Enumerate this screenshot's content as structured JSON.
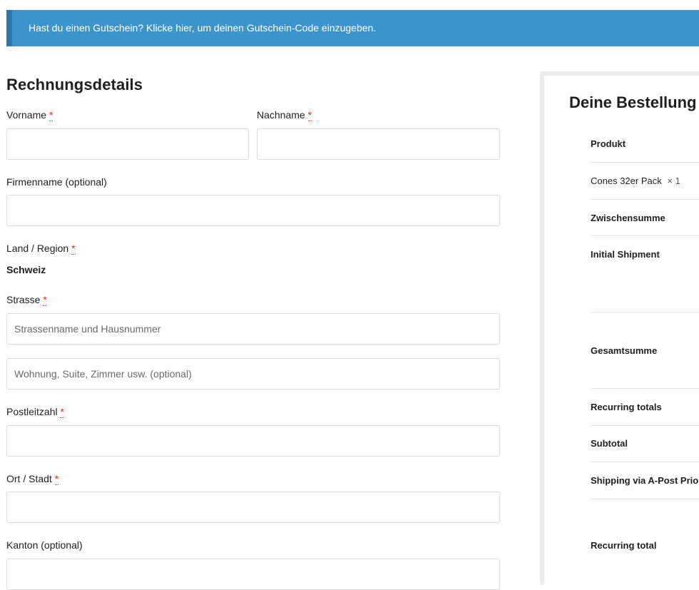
{
  "notice": {
    "text": "Hast du einen Gutschein? Klicke hier, um deinen Gutschein-Code einzugeben."
  },
  "billing": {
    "title": "Rechnungsdetails",
    "required_mark": "*",
    "first_name_label": "Vorname",
    "last_name_label": "Nachname",
    "company_label": "Firmenname (optional)",
    "country_label": "Land / Region",
    "country_value": "Schweiz",
    "street_label": "Strasse",
    "street_placeholder": "Strassenname und Hausnummer",
    "street2_placeholder": "Wohnung, Suite, Zimmer usw. (optional)",
    "zip_label": "Postleitzahl",
    "city_label": "Ort / Stadt",
    "canton_label": "Kanton (optional)"
  },
  "order": {
    "title": "Deine Bestellung",
    "product_header": "Produkt",
    "product_name": "Cones 32er Pack",
    "product_qty": "× 1",
    "subtotal_label": "Zwischensumme",
    "initial_shipment_label": "Initial Shipment",
    "total_label": "Gesamtsumme",
    "recurring_totals_label": "Recurring totals",
    "recurring_subtotal_label": "Subtotal",
    "recurring_shipping_label": "Shipping via A-Post Priority",
    "recurring_total_label": "Recurring total"
  }
}
